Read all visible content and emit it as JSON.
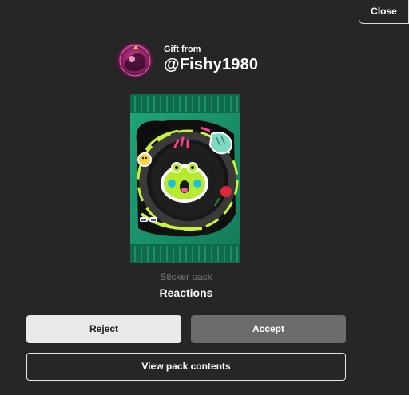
{
  "header": {
    "close_label": "Close"
  },
  "gift": {
    "from_label": "Gift from",
    "username": "@Fishy1980"
  },
  "pack": {
    "type_label": "Sticker pack",
    "name": "Reactions"
  },
  "actions": {
    "reject_label": "Reject",
    "accept_label": "Accept",
    "view_contents_label": "View pack contents"
  },
  "colors": {
    "background": "#262626",
    "pack_green": "#1e9a70",
    "accent_lime": "#c8f23c",
    "accent_pink": "#ff3d8b"
  }
}
